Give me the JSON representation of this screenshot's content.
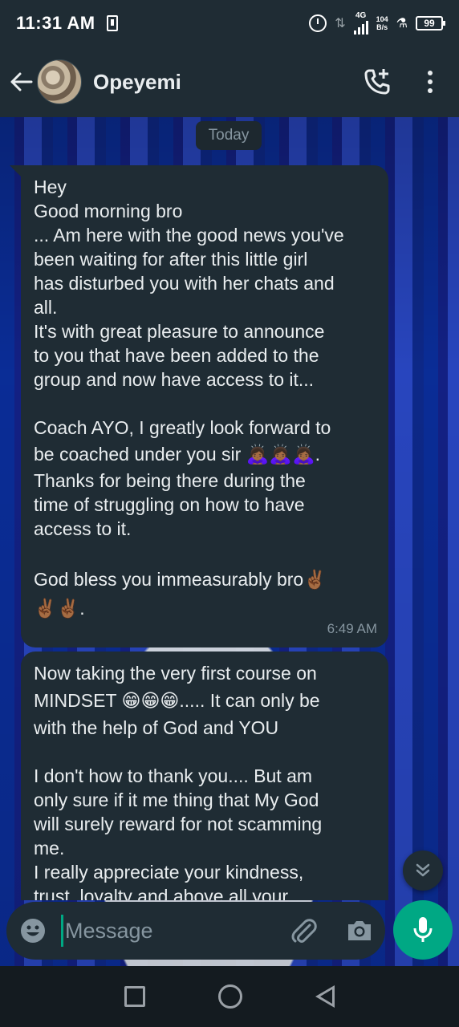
{
  "status_bar": {
    "time": "11:31 AM",
    "network": "4G",
    "speed_value": "104",
    "speed_unit": "B/s",
    "battery": "99"
  },
  "chat_header": {
    "contact_name": "Opeyemi",
    "icons": [
      "back-arrow-icon",
      "contact-avatar",
      "add-call-icon",
      "more-vert-icon"
    ]
  },
  "chat": {
    "date_label": "Today",
    "messages": [
      {
        "lines": [
          "Hey",
          "Good morning bro",
          "... Am here with the good news you've",
          "been waiting for after this little girl",
          "has disturbed you with her chats and",
          "all.",
          "It's with great pleasure to announce",
          "to you that have been added to the",
          "group and now have access to it...",
          "",
          "Coach AYO, I greatly look forward to",
          "be coached under you sir 🙇🏾‍♀️🙇🏾‍♀️🙇🏾‍♀️.",
          "Thanks for being there during the",
          "time of struggling on how to have",
          "access to it.",
          "",
          "God bless you immeasurably bro✌🏾",
          "✌🏾✌🏾."
        ],
        "time": "6:49 AM"
      },
      {
        "lines": [
          "Now taking the very first course on",
          "MINDSET 😁😁😁..... It can only be",
          "with the help of God and YOU",
          "",
          "I don't how to thank you.... But am",
          "only sure if it me thing that My God",
          "will surely reward for not scamming",
          "me.",
          "I really appreciate your kindness,",
          "trust, loyalty and above all your"
        ]
      }
    ]
  },
  "composer": {
    "placeholder": "Message",
    "icons": [
      "emoji-icon",
      "attach-icon",
      "camera-icon",
      "mic-icon"
    ]
  },
  "colors": {
    "accent": "#00a884",
    "bubble": "#1f2c34",
    "header": "#1f2c34",
    "text": "#e9edef",
    "meta": "#8696a0"
  }
}
